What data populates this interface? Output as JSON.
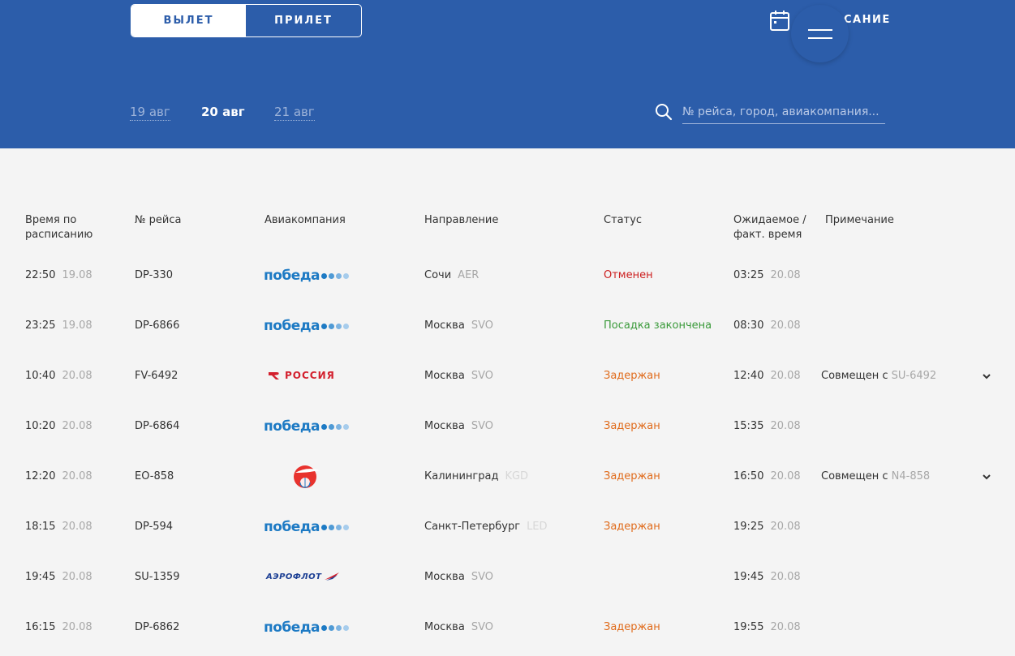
{
  "header": {
    "tabs": [
      {
        "label": "ВЫЛЕТ",
        "active": true
      },
      {
        "label": "ПРИЛЕТ",
        "active": false
      }
    ],
    "schedule_label": "САНИЕ",
    "dates": [
      {
        "label": "19 авг",
        "active": false
      },
      {
        "label": "20 авг",
        "active": true
      },
      {
        "label": "21 авг",
        "active": false
      }
    ],
    "search": {
      "placeholder": "№ рейса, город, авиакомпания..."
    }
  },
  "table": {
    "columns": [
      "Время по расписанию",
      "№ рейса",
      "Авиакомпания",
      "Направление",
      "Статус",
      "Ожидаемое / факт. время",
      "Примечание"
    ],
    "rows": [
      {
        "time": "22:50",
        "date": "19.08",
        "flight": "DP-330",
        "airline": "победа",
        "city": "Сочи",
        "code": "AER",
        "status": "Отменен",
        "status_type": "red",
        "exp_time": "03:25",
        "exp_date": "20.08",
        "note_prefix": "",
        "note_code": ""
      },
      {
        "time": "23:25",
        "date": "19.08",
        "flight": "DP-6866",
        "airline": "победа",
        "city": "Москва",
        "code": "SVO",
        "status": "Посадка закончена",
        "status_type": "green",
        "exp_time": "08:30",
        "exp_date": "20.08",
        "note_prefix": "",
        "note_code": ""
      },
      {
        "time": "10:40",
        "date": "20.08",
        "flight": "FV-6492",
        "airline": "РОССИЯ",
        "city": "Москва",
        "code": "SVO",
        "status": "Задержан",
        "status_type": "orange",
        "exp_time": "12:40",
        "exp_date": "20.08",
        "note_prefix": "Совмещен с ",
        "note_code": "SU-6492"
      },
      {
        "time": "10:20",
        "date": "20.08",
        "flight": "DP-6864",
        "airline": "победа",
        "city": "Москва",
        "code": "SVO",
        "status": "Задержан",
        "status_type": "orange",
        "exp_time": "15:35",
        "exp_date": "20.08",
        "note_prefix": "",
        "note_code": ""
      },
      {
        "time": "12:20",
        "date": "20.08",
        "flight": "EO-858",
        "airline": "globe-logo",
        "city": "Калининград",
        "code": "KGD",
        "status": "Задержан",
        "status_type": "orange",
        "exp_time": "16:50",
        "exp_date": "20.08",
        "note_prefix": "Совмещен с ",
        "note_code": "N4-858"
      },
      {
        "time": "18:15",
        "date": "20.08",
        "flight": "DP-594",
        "airline": "победа",
        "city": "Санкт-Петербург",
        "code": "LED",
        "status": "Задержан",
        "status_type": "orange",
        "exp_time": "19:25",
        "exp_date": "20.08",
        "note_prefix": "",
        "note_code": ""
      },
      {
        "time": "19:45",
        "date": "20.08",
        "flight": "SU-1359",
        "airline": "АЭРОФЛОТ",
        "city": "Москва",
        "code": "SVO",
        "status": "",
        "status_type": "none",
        "exp_time": "19:45",
        "exp_date": "20.08",
        "note_prefix": "",
        "note_code": ""
      },
      {
        "time": "16:15",
        "date": "20.08",
        "flight": "DP-6862",
        "airline": "победа",
        "city": "Москва",
        "code": "SVO",
        "status": "Задержан",
        "status_type": "orange",
        "exp_time": "19:55",
        "exp_date": "20.08",
        "note_prefix": "",
        "note_code": ""
      }
    ]
  },
  "colors": {
    "header_bg": "#2c5daa",
    "status_red": "#cc1f1f",
    "status_green": "#3a9a3a",
    "status_orange": "#e06b1b",
    "pobeda_blue": "#1d7ac4",
    "rossiya_red": "#d3202e",
    "aeroflot_blue": "#1c3f94"
  }
}
